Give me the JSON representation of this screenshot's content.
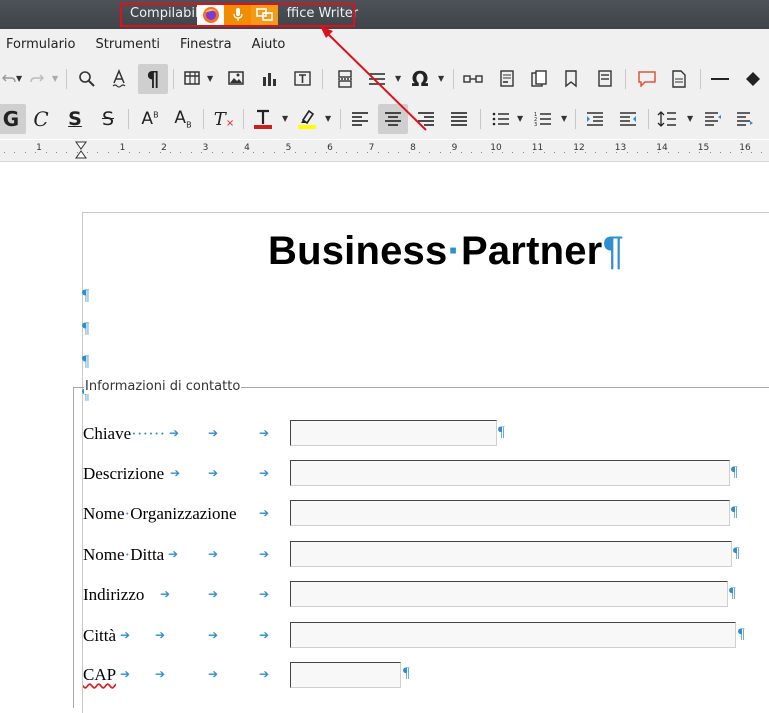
{
  "window": {
    "title": "Compilabile - LibreOffice Writer",
    "title_visible_left": "Compilabil",
    "title_visible_right": "ffice Writer",
    "overlay_icons": [
      "firefox-icon",
      "microphone-icon",
      "window-switch-icon"
    ]
  },
  "menubar": {
    "items": [
      "Formulario",
      "Strumenti",
      "Finestra",
      "Aiuto"
    ]
  },
  "ruler": {
    "numbers": [
      "1",
      "1",
      "2",
      "3",
      "4",
      "5",
      "6",
      "7",
      "8",
      "9",
      "10",
      "11",
      "12",
      "13",
      "14",
      "15",
      "16"
    ]
  },
  "document": {
    "title_word1": "Business",
    "title_separator": "·",
    "title_word2": "Partner",
    "pilcrow": "¶",
    "tab_arrow": "➔",
    "group_label": "Informazioni di contatto",
    "fields": [
      {
        "label": "Chiave",
        "label_suffix": "······"
      },
      {
        "label": "Descrizione",
        "label_suffix": ""
      },
      {
        "label_part1": "Nome",
        "label_part2": "Organizzazione",
        "label_suffix": ""
      },
      {
        "label_part1": "Nome",
        "label_part2": "Ditta",
        "label_suffix": ""
      },
      {
        "label": "Indirizzo",
        "label_suffix": ""
      },
      {
        "label": "Città",
        "label_suffix": ""
      },
      {
        "label": "CAP",
        "label_suffix": ""
      }
    ]
  },
  "colors": {
    "annotation": "#e0101a",
    "formatting_marks": "#2f8ed1",
    "titlebar": "#45494e",
    "toolbar_bg": "#f0f0f0"
  }
}
